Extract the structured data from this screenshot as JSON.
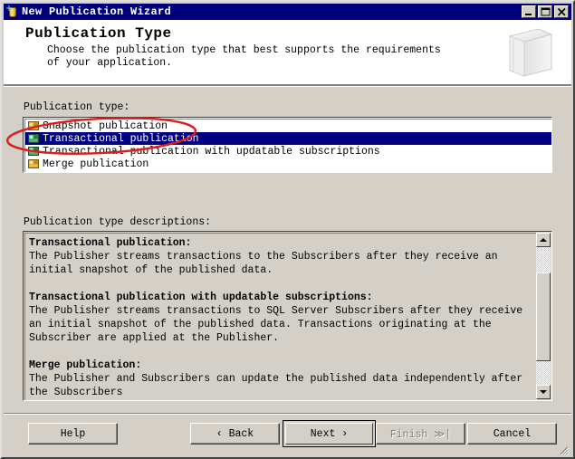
{
  "window": {
    "title": "New Publication Wizard",
    "icon": "publication-wizard-icon",
    "controls": {
      "minimize": "minimize-button",
      "maximize": "maximize-button",
      "close": "close-button"
    },
    "colors": {
      "titlebar": "#00007b",
      "face": "#d4d0c8",
      "selection": "#000080",
      "annotation": "#e01b1b"
    }
  },
  "header": {
    "title": "Publication Type",
    "description": "Choose the publication type that best supports the requirements of your application.",
    "graphic": "database-book-graphic"
  },
  "body": {
    "list_label": "Publication type:",
    "desc_label": "Publication type descriptions:",
    "publication_types": [
      {
        "label": "Snapshot publication",
        "selected": false,
        "icon_color": "#d8a020"
      },
      {
        "label": "Transactional publication",
        "selected": true,
        "icon_color": "#3a9a5a"
      },
      {
        "label": "Transactional publication with updatable subscriptions",
        "selected": false,
        "icon_color": "#3a9a5a"
      },
      {
        "label": "Merge publication",
        "selected": false,
        "icon_color": "#d8a020"
      }
    ],
    "descriptions": [
      {
        "heading": "Transactional publication:",
        "text": "The Publisher streams transactions to the Subscribers after they receive an initial snapshot of the published data."
      },
      {
        "heading": "Transactional publication with updatable subscriptions:",
        "text": "The Publisher streams transactions to SQL Server Subscribers after they receive an initial snapshot of the published data. Transactions originating at the Subscriber are applied at the Publisher."
      },
      {
        "heading": "Merge publication:",
        "text": "The Publisher and Subscribers can update the published data independently after the Subscribers"
      }
    ],
    "scrollbar": {
      "up_arrow": "scroll-up-arrow",
      "down_arrow": "scroll-down-arrow"
    }
  },
  "buttons": {
    "help": "Help",
    "back": "‹ Back",
    "next": "Next ›",
    "finish": "Finish ≫|",
    "cancel": "Cancel"
  },
  "annotation": {
    "type": "red-ellipse",
    "target": "Transactional publication"
  }
}
